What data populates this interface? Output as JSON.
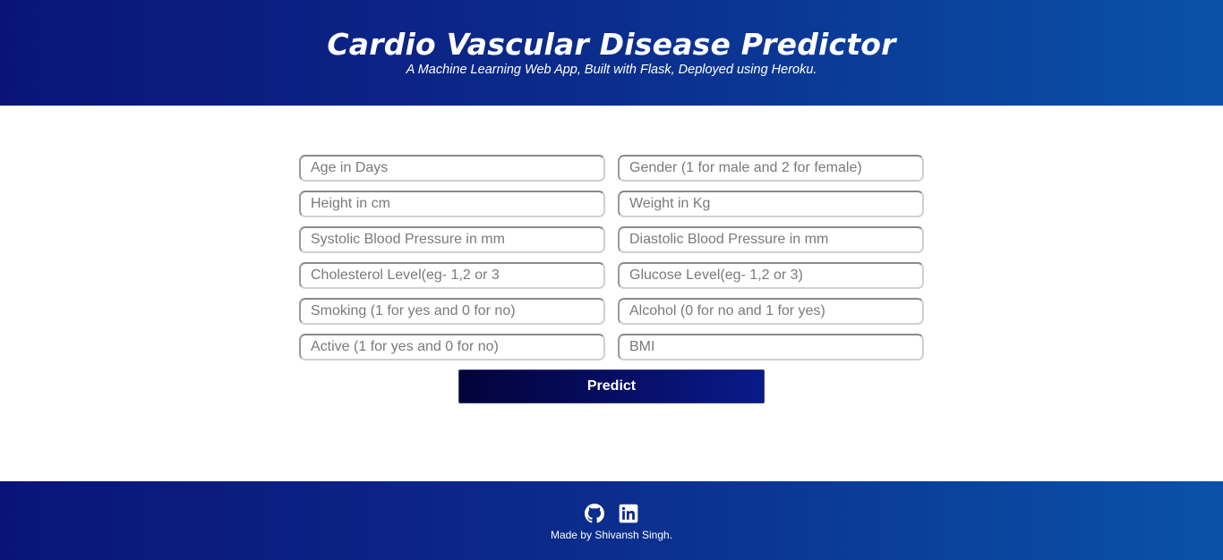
{
  "header": {
    "title": "Cardio Vascular Disease Predictor",
    "subtitle": "A Machine Learning Web App, Built with Flask, Deployed using Heroku."
  },
  "form": {
    "fields": [
      {
        "placeholder": "Age in Days"
      },
      {
        "placeholder": "Gender (1 for male and 2 for female)"
      },
      {
        "placeholder": "Height in cm"
      },
      {
        "placeholder": "Weight in Kg"
      },
      {
        "placeholder": "Systolic Blood Pressure in mm"
      },
      {
        "placeholder": "Diastolic Blood Pressure in mm"
      },
      {
        "placeholder": "Cholesterol Level(eg- 1,2 or 3"
      },
      {
        "placeholder": "Glucose Level(eg- 1,2 or 3)"
      },
      {
        "placeholder": "Smoking (1 for yes and 0 for no)"
      },
      {
        "placeholder": "Alcohol (0 for no and 1 for yes)"
      },
      {
        "placeholder": "Active (1 for yes and 0 for no)"
      },
      {
        "placeholder": "BMI"
      }
    ],
    "submit_label": "Predict"
  },
  "footer": {
    "icons": [
      "github-icon",
      "linkedin-icon"
    ],
    "credit": "Made by Shivansh Singh."
  },
  "colors": {
    "header_gradient_start": "#0a1478",
    "header_gradient_end": "#0a52a8",
    "button_gradient_start": "#03033a",
    "button_gradient_end": "#0a1a8a"
  }
}
